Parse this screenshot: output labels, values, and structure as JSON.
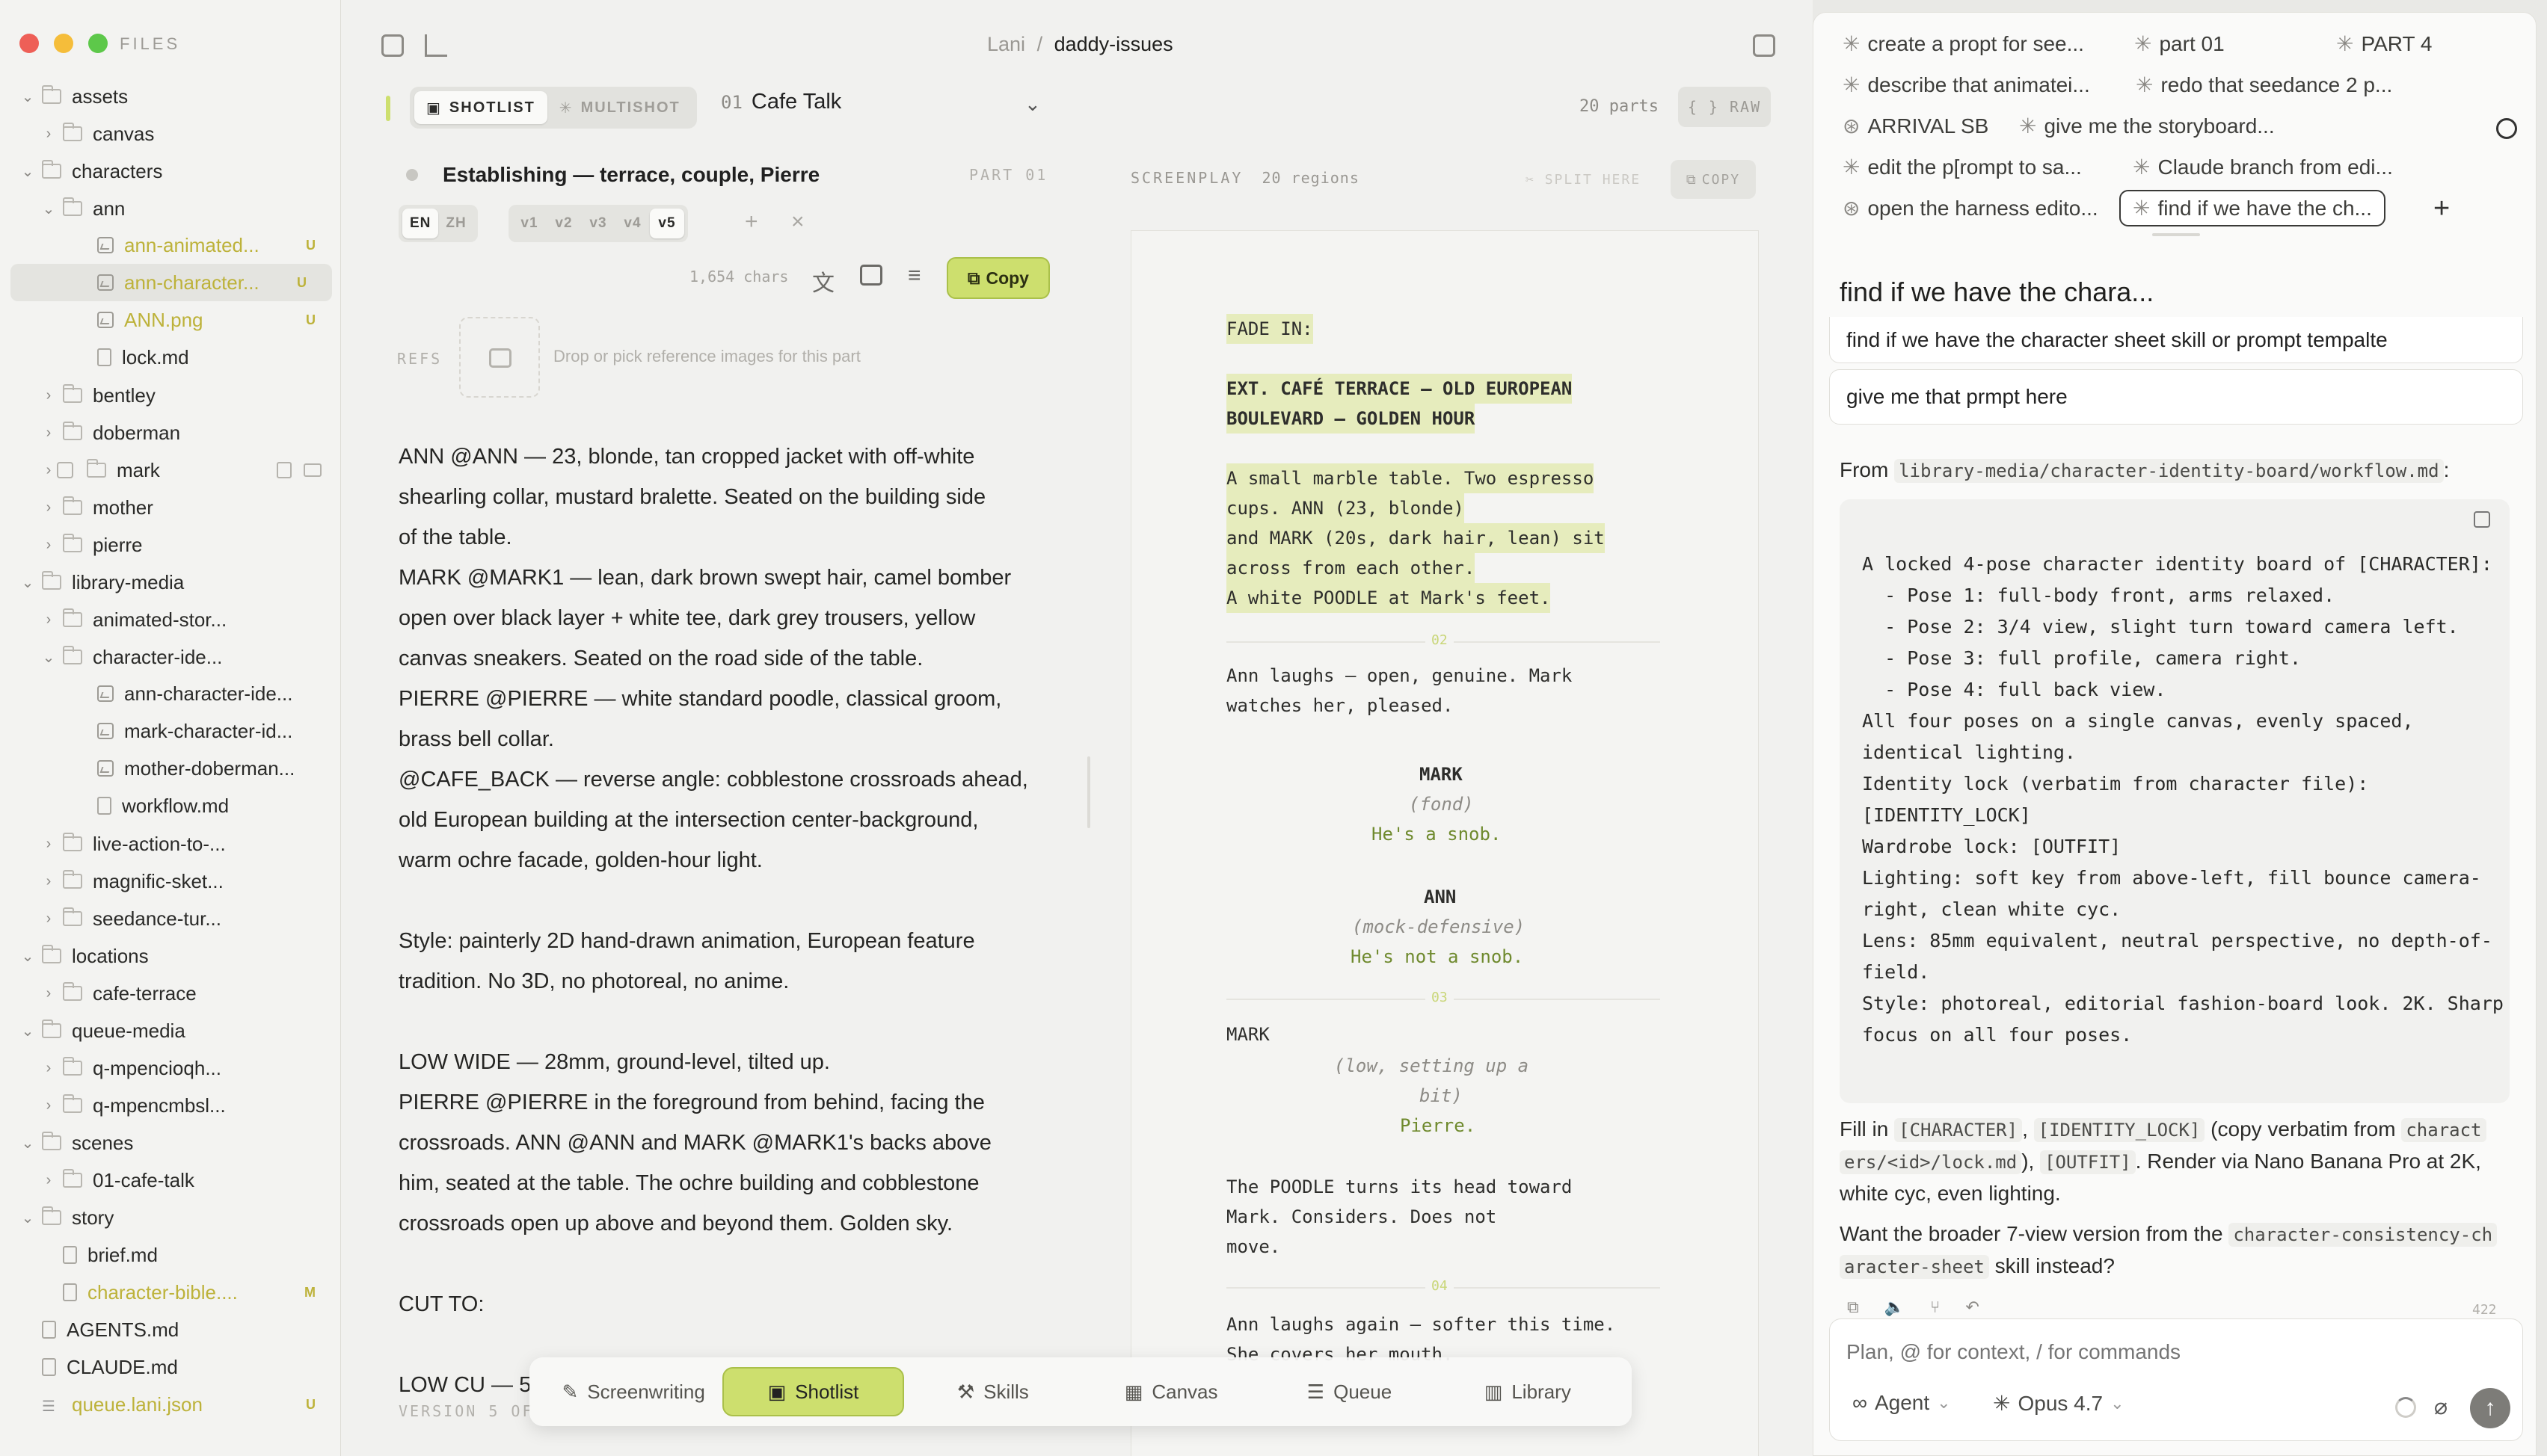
{
  "files": {
    "title": "FILES",
    "rows": [
      {
        "label": "assets",
        "type": "folder",
        "open": true,
        "depth": 0,
        "badge": ""
      },
      {
        "label": "canvas",
        "type": "folder",
        "open": false,
        "depth": 1,
        "badge": ""
      },
      {
        "label": "characters",
        "type": "folder",
        "open": true,
        "depth": 0,
        "badge": ""
      },
      {
        "label": "ann",
        "type": "folder",
        "open": true,
        "depth": 1,
        "badge": ""
      },
      {
        "label": "ann-animated...",
        "type": "image",
        "depth": 2,
        "badge": "U",
        "modified": true
      },
      {
        "label": "ann-character...",
        "type": "image",
        "depth": 2,
        "badge": "U",
        "modified": true,
        "selected": true
      },
      {
        "label": "ANN.png",
        "type": "image",
        "depth": 2,
        "badge": "U",
        "modified": true
      },
      {
        "label": "lock.md",
        "type": "file",
        "depth": 2,
        "badge": ""
      },
      {
        "label": "bentley",
        "type": "folder",
        "open": false,
        "depth": 1,
        "badge": ""
      },
      {
        "label": "doberman",
        "type": "folder",
        "open": false,
        "depth": 1,
        "badge": ""
      },
      {
        "label": "mark",
        "type": "folder",
        "open": false,
        "depth": 1,
        "badge": "",
        "hover": true
      },
      {
        "label": "mother",
        "type": "folder",
        "open": false,
        "depth": 1,
        "badge": ""
      },
      {
        "label": "pierre",
        "type": "folder",
        "open": false,
        "depth": 1,
        "badge": ""
      },
      {
        "label": "library-media",
        "type": "folder",
        "open": true,
        "depth": 0,
        "badge": ""
      },
      {
        "label": "animated-stor...",
        "type": "folder",
        "open": false,
        "depth": 1,
        "badge": ""
      },
      {
        "label": "character-ide...",
        "type": "folder",
        "open": true,
        "depth": 1,
        "badge": ""
      },
      {
        "label": "ann-character-ide...",
        "type": "image",
        "depth": 2,
        "badge": ""
      },
      {
        "label": "mark-character-id...",
        "type": "image",
        "depth": 2,
        "badge": ""
      },
      {
        "label": "mother-doberman...",
        "type": "image",
        "depth": 2,
        "badge": ""
      },
      {
        "label": "workflow.md",
        "type": "file",
        "depth": 2,
        "badge": ""
      },
      {
        "label": "live-action-to-...",
        "type": "folder",
        "open": false,
        "depth": 1,
        "badge": ""
      },
      {
        "label": "magnific-sket...",
        "type": "folder",
        "open": false,
        "depth": 1,
        "badge": ""
      },
      {
        "label": "seedance-tur...",
        "type": "folder",
        "open": false,
        "depth": 1,
        "badge": ""
      },
      {
        "label": "locations",
        "type": "folder",
        "open": true,
        "depth": 0,
        "badge": ""
      },
      {
        "label": "cafe-terrace",
        "type": "folder",
        "open": false,
        "depth": 1,
        "badge": ""
      },
      {
        "label": "queue-media",
        "type": "folder",
        "open": true,
        "depth": 0,
        "badge": ""
      },
      {
        "label": "q-mpencioqh...",
        "type": "folder",
        "open": false,
        "depth": 1,
        "badge": ""
      },
      {
        "label": "q-mpencmbsl...",
        "type": "folder",
        "open": false,
        "depth": 1,
        "badge": ""
      },
      {
        "label": "scenes",
        "type": "folder",
        "open": true,
        "depth": 0,
        "badge": ""
      },
      {
        "label": "01-cafe-talk",
        "type": "folder",
        "open": false,
        "depth": 1,
        "badge": ""
      },
      {
        "label": "story",
        "type": "folder",
        "open": true,
        "depth": 0,
        "badge": ""
      },
      {
        "label": "brief.md",
        "type": "file",
        "depth": 1,
        "badge": ""
      },
      {
        "label": "character-bible....",
        "type": "file",
        "depth": 1,
        "badge": "M",
        "modified": true
      },
      {
        "label": "AGENTS.md",
        "type": "file",
        "depth": 0,
        "badge": ""
      },
      {
        "label": "CLAUDE.md",
        "type": "file",
        "depth": 0,
        "badge": ""
      },
      {
        "label": "queue.lani.json",
        "type": "list",
        "depth": 0,
        "badge": "U",
        "modified": true
      }
    ]
  },
  "header": {
    "crumb_root": "Lani",
    "crumb_sep": "/",
    "crumb_current": "daddy-issues"
  },
  "toolbar": {
    "shotlist": "SHOTLIST",
    "multishot": "MULTISHOT",
    "part_num": "01",
    "part_name": "Cafe Talk",
    "parts_count": "20 parts",
    "raw": "{ } RAW"
  },
  "part": {
    "title": "Establishing — terrace, couple, Pierre",
    "label": "PART 01",
    "langs": [
      "EN",
      "ZH"
    ],
    "versions": [
      "v1",
      "v2",
      "v3",
      "v4",
      "v5"
    ],
    "active_version": "v5",
    "chars": "1,654 chars",
    "copy": "Copy",
    "refs_label": "REFS",
    "refs_hint": "Drop or pick reference images for this part",
    "footer": "VERSION 5 OF"
  },
  "prompt_lines": [
    "ANN @ANN — 23, blonde, tan cropped jacket with off-white",
    "shearling collar, mustard bralette. Seated on the building side",
    "of the table.",
    "MARK @MARK1 — lean, dark brown swept hair, camel bomber",
    "open over black layer + white tee, dark grey trousers, yellow",
    "canvas sneakers. Seated on the road side of the table.",
    "PIERRE @PIERRE — white standard poodle, classical groom,",
    "brass bell collar.",
    "@CAFE_BACK — reverse angle: cobblestone crossroads ahead,",
    "old European building at the intersection center-background,",
    "warm ochre facade, golden-hour light.",
    "",
    "Style: painterly 2D hand-drawn animation, European feature",
    "tradition. No 3D, no photoreal, no anime.",
    "",
    "LOW WIDE — 28mm, ground-level, tilted up.",
    "PIERRE @PIERRE in the foreground from behind, facing the",
    "crossroads. ANN @ANN and MARK @MARK1's backs above",
    "him, seated at the table. The ochre building and cobblestone",
    "crossroads open up above and beyond them. Golden sky.",
    "",
    "CUT TO:",
    "",
    "LOW CU — 5"
  ],
  "screenplay": {
    "label": "SCREENPLAY",
    "regions": "20 regions",
    "split": "SPLIT HERE",
    "copy": "COPY",
    "fade_in": "FADE IN:",
    "slug1": "EXT. CAFÉ TERRACE — OLD EUROPEAN",
    "slug2": "BOULEVARD — GOLDEN HOUR",
    "action1": [
      "A small marble table. Two espresso",
      "cups. ANN (23, blonde)",
      "and MARK (20s, dark hair, lean) sit",
      "across from each other.",
      "A white POODLE at Mark's feet."
    ],
    "div2": "02",
    "action2": [
      "Ann laughs — open, genuine. Mark",
      "watches her, pleased."
    ],
    "char_mark": "MARK",
    "paren_fond": "(fond)",
    "line_snob": "He's a snob.",
    "char_ann": "ANN",
    "paren_mock": "(mock-defensive)",
    "line_notsnob": "He's not a snob.",
    "div3": "03",
    "char_mark2": "MARK",
    "paren_low1": "(low, setting up a",
    "paren_low2": "bit)",
    "line_pierre": "Pierre.",
    "action3": [
      "The POODLE turns its head toward",
      "Mark. Considers. Does not",
      "move."
    ],
    "div4": "04",
    "action4": [
      "Ann laughs again — softer this time.",
      "She covers her mouth."
    ]
  },
  "dock": {
    "items": [
      {
        "label": "Screenwriting",
        "icon": "pencil-icon"
      },
      {
        "label": "Shotlist",
        "icon": "film-icon",
        "active": true
      },
      {
        "label": "Skills",
        "icon": "wrench-icon"
      },
      {
        "label": "Canvas",
        "icon": "grid-icon"
      },
      {
        "label": "Queue",
        "icon": "list-icon"
      },
      {
        "label": "Library",
        "icon": "book-icon"
      }
    ]
  },
  "chat": {
    "threads": [
      [
        "create a propt for see...",
        "part 01",
        "PART 4"
      ],
      [
        "describe that animatei...",
        "redo that seedance 2 p..."
      ],
      [
        "ARRIVAL SB",
        "give me the storyboard..."
      ],
      [
        "edit the p[rompt to sa...",
        "Claude branch from edi..."
      ],
      [
        "open the harness edito...",
        "find if we have the ch..."
      ]
    ],
    "title": "find if we have the chara...",
    "user_msg_1": "find if we have the character sheet skill or prompt tempalte",
    "user_msg_2": "give me that prmpt here",
    "from_label": "From",
    "from_path": "library-media/character-identity-board/workflow.md",
    "from_colon": ":",
    "code_lines": [
      "A locked 4-pose character identity board of [CHARACTER]:",
      "  - Pose 1: full-body front, arms relaxed.",
      "  - Pose 2: 3/4 view, slight turn toward camera left.",
      "  - Pose 3: full profile, camera right.",
      "  - Pose 4: full back view.",
      "All four poses on a single canvas, evenly spaced,",
      "identical lighting.",
      "Identity lock (verbatim from character file):",
      "[IDENTITY_LOCK]",
      "Wardrobe lock: [OUTFIT]",
      "Lighting: soft key from above-left, fill bounce camera-",
      "right, clean white cyc.",
      "Lens: 85mm equivalent, neutral perspective, no depth-of-",
      "field.",
      "Style: photoreal, editorial fashion-board look. 2K. Sharp",
      "focus on all four poses."
    ],
    "fill_a": "Fill in",
    "fill_c1": "[CHARACTER]",
    "fill_comma": ",",
    "fill_c2": "[IDENTITY_LOCK]",
    "fill_b": "(copy verbatim from",
    "fill_c3a": "charact",
    "fill_c3b": "ers/<id>/lock.md",
    "fill_c": "),",
    "fill_c4": "[OUTFIT]",
    "fill_d": ". Render via Nano Banana Pro at 2K,",
    "fill_e": "white cyc, even lighting.",
    "want_a": "Want the broader 7-view version from the",
    "want_c1a": "character-consistency-ch",
    "want_c1b": "aracter-sheet",
    "want_b": "skill instead?",
    "token_count": "422",
    "placeholder": "Plan, @ for context, / for commands",
    "mode": "Agent",
    "model": "Opus 4.7"
  },
  "colors": {
    "accent": "#cddf6e",
    "accent_border": "#aac04a",
    "modified": "#bdb23a",
    "highlight": "#e6ecbd"
  }
}
